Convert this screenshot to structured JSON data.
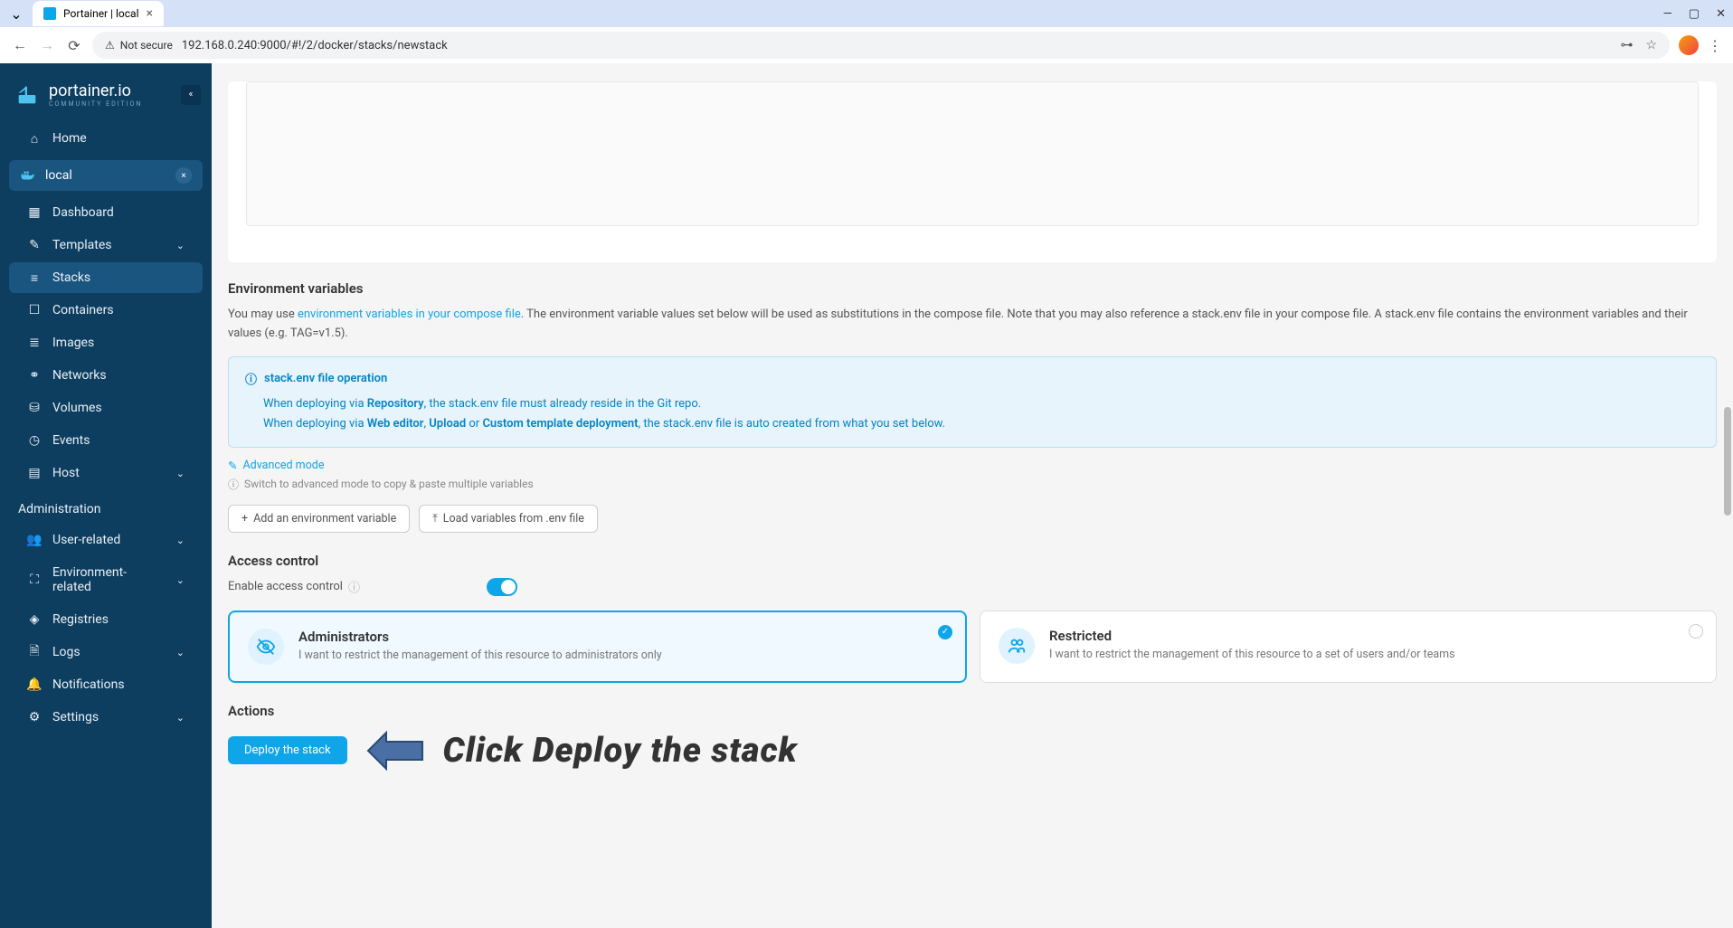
{
  "browser": {
    "tab_title": "Portainer | local",
    "security_label": "Not secure",
    "url": "192.168.0.240:9000/#!/2/docker/stacks/newstack"
  },
  "logo": {
    "name": "portainer.io",
    "tagline": "COMMUNITY EDITION"
  },
  "sidebar": {
    "home": "Home",
    "env_name": "local",
    "items": {
      "dashboard": "Dashboard",
      "templates": "Templates",
      "stacks": "Stacks",
      "containers": "Containers",
      "images": "Images",
      "networks": "Networks",
      "volumes": "Volumes",
      "events": "Events",
      "host": "Host"
    },
    "admin_header": "Administration",
    "admin": {
      "user": "User-related",
      "environment": "Environment-related",
      "registries": "Registries",
      "logs": "Logs",
      "notifications": "Notifications",
      "settings": "Settings"
    }
  },
  "content": {
    "env_title": "Environment variables",
    "env_desc_prefix": "You may use ",
    "env_desc_link": "environment variables in your compose file",
    "env_desc_suffix": ". The environment variable values set below will be used as substitutions in the compose file. Note that you may also reference a stack.env file in your compose file. A stack.env file contains the environment variables and their values (e.g. TAG=v1.5).",
    "info_title": "stack.env file operation",
    "info_line1_a": "When deploying via ",
    "info_line1_b": "Repository",
    "info_line1_c": ", the stack.env file must already reside in the Git repo.",
    "info_line2_a": "When deploying via ",
    "info_line2_b": "Web editor",
    "info_line2_c": ", ",
    "info_line2_d": "Upload",
    "info_line2_e": " or ",
    "info_line2_f": "Custom template deployment",
    "info_line2_g": ", the stack.env file is auto created from what you set below.",
    "advanced_link": "Advanced mode",
    "advanced_hint": "Switch to advanced mode to copy & paste multiple variables",
    "btn_add": "Add an environment variable",
    "btn_load": "Load variables from .env file",
    "access_title": "Access control",
    "access_toggle_label": "Enable access control",
    "access_admin_title": "Administrators",
    "access_admin_desc": "I want to restrict the management of this resource to administrators only",
    "access_restricted_title": "Restricted",
    "access_restricted_desc": "I want to restrict the management of this resource to a set of users and/or teams",
    "actions_title": "Actions",
    "deploy_btn": "Deploy the stack",
    "annotation": "Click Deploy the stack"
  }
}
